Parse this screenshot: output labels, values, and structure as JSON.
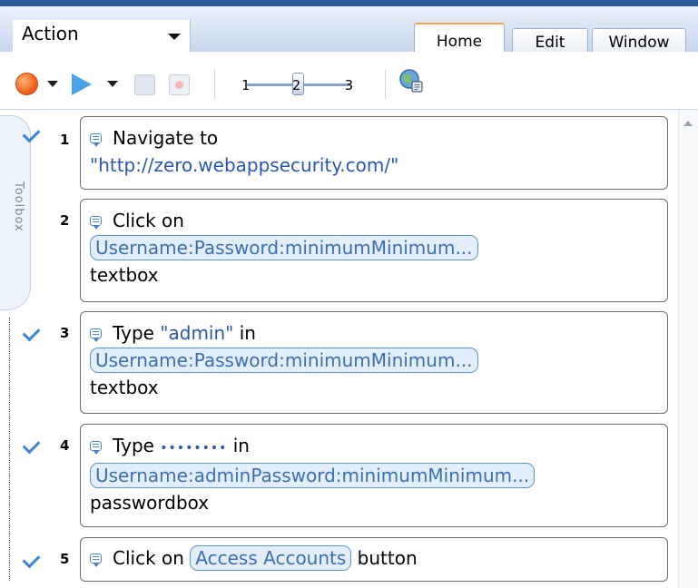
{
  "header": {
    "action_label": "Action",
    "tabs": [
      {
        "label": "Home"
      },
      {
        "label": "Edit"
      },
      {
        "label": "Window"
      }
    ]
  },
  "toolbar": {
    "slider_ticks": [
      "1",
      "2",
      "3"
    ],
    "speed_value": 2
  },
  "toolbox": {
    "label": "Toolbox"
  },
  "steps": [
    {
      "num": "1",
      "checked": true,
      "verb": "Navigate to",
      "url": "\"http://zero.webappsecurity.com/\""
    },
    {
      "num": "2",
      "checked": false,
      "verb": "Click on",
      "target": "Username:Password:minimumMinimum...",
      "kind": "textbox"
    },
    {
      "num": "3",
      "checked": true,
      "verb": "Type",
      "value": "\"admin\"",
      "prep": "in",
      "target": "Username:Password:minimumMinimum...",
      "kind": "textbox"
    },
    {
      "num": "4",
      "checked": true,
      "verb": "Type",
      "value": "••••••••",
      "prep": "in",
      "target": "Username:adminPassword:minimumMinimum...",
      "kind": "passwordbox"
    },
    {
      "num": "5",
      "checked": true,
      "verb": "Click on",
      "target": "Access Accounts",
      "kind": "button"
    }
  ]
}
